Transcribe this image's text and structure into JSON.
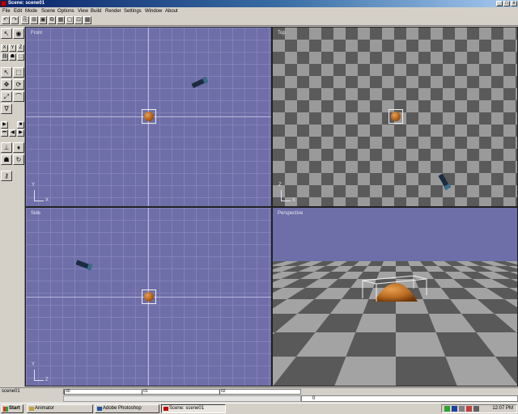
{
  "window": {
    "title": "Scene: scene01",
    "minimize_glyph": "_",
    "maximize_glyph": "□",
    "close_glyph": "x"
  },
  "menu": [
    "File",
    "Edit",
    "Mode",
    "Scene",
    "Options",
    "View",
    "Build",
    "Render",
    "Settings",
    "Window",
    "About"
  ],
  "toolbar": {
    "icons": [
      "undo-icon",
      "redo-icon",
      "new-icon",
      "open-icon",
      "save-icon",
      "cut-icon",
      "copy-icon",
      "paste-icon",
      "render-icon",
      "camera-icon"
    ],
    "glyphs": [
      "↶",
      "↷",
      "⎘",
      "⊞",
      "▣",
      "⧉",
      "▦",
      "▢",
      "⊡",
      "▩"
    ]
  },
  "tools": {
    "select_glyph": "↖",
    "view_glyph": "◉",
    "axis": [
      "X",
      "Y",
      "Z"
    ],
    "move_glyph": "✥",
    "rotate_glyph": "⟳",
    "scale_glyph": "⤢",
    "lasso_glyph": "⌒",
    "box_glyph": "⬚",
    "bend_glyph": "∿",
    "magnet_glyph": "∇",
    "play_glyph": "▶",
    "stop_glyph": "■",
    "rewind_glyph": "⏮",
    "prev_glyph": "◀",
    "next_glyph": "▶",
    "end_glyph": "⏭",
    "bone_glyph": "⊥",
    "morph_glyph": "♦",
    "human_glyph": "☗",
    "refresh_glyph": "↻",
    "key_glyph": "⚷",
    "chain_glyph": "⛓"
  },
  "viewports": {
    "front": {
      "label": "Front",
      "axis_v": "Y",
      "axis_h": "X"
    },
    "top": {
      "label": "Top",
      "axis_v": "Z",
      "axis_h": "X"
    },
    "side": {
      "label": "Side",
      "axis_v": "Y",
      "axis_h": "Z"
    },
    "perspective": {
      "label": "Perspective"
    }
  },
  "timeline": {
    "scene_name": "scene01",
    "ticks": [
      "00",
      "01",
      "02"
    ],
    "current_frame": "0"
  },
  "taskbar": {
    "start_label": "Start",
    "tasks": [
      {
        "label": "Animator",
        "active": false
      },
      {
        "label": "Adobe Photoshop",
        "active": false
      },
      {
        "label": "Scene: scene01",
        "active": true
      }
    ],
    "clock": "12:07 PM"
  },
  "colors": {
    "viewport_bg": "#6e6ea8",
    "object_orange": "#c87830",
    "title_bar": "#0a246a"
  }
}
